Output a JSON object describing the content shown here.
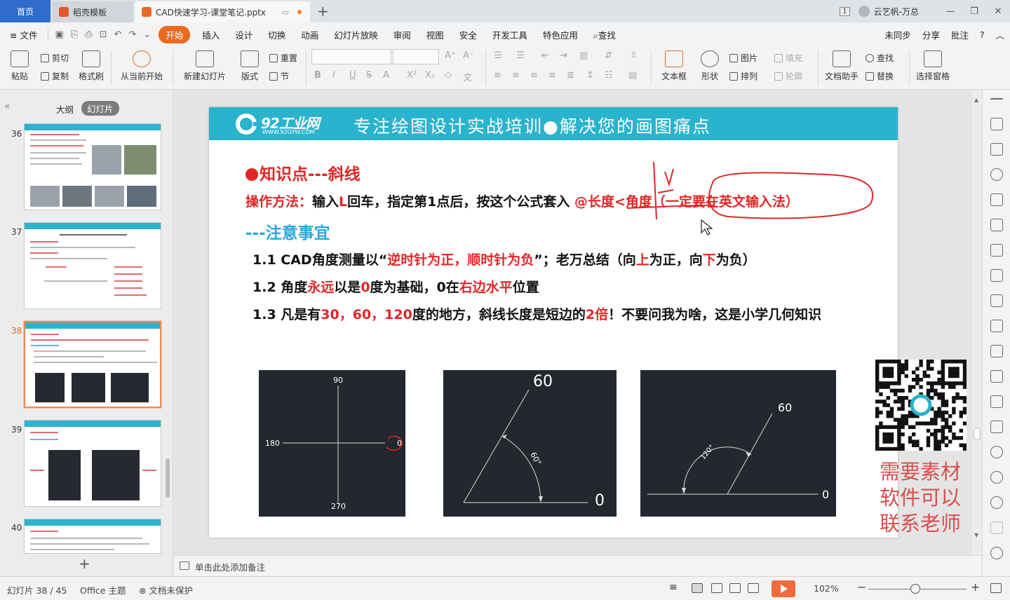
{
  "tabs": {
    "home": "首页",
    "template": "稻壳模板",
    "document": "CAD快速学习-课堂笔记.pptx",
    "add": "+"
  },
  "titlebar": {
    "window_count": "1",
    "user": "云艺帆-万总",
    "minimize": "—",
    "restore": "❐",
    "close": "✕"
  },
  "menu": {
    "file": "≡ 文件",
    "items": [
      "开始",
      "插入",
      "设计",
      "切换",
      "动画",
      "幻灯片放映",
      "审阅",
      "视图",
      "安全",
      "开发工具",
      "特色应用"
    ],
    "search": "查找",
    "right": [
      "未同步",
      "分享",
      "批注",
      "?",
      "︿"
    ]
  },
  "ribbon": {
    "paste": "粘贴",
    "cut": "剪切",
    "copy": "复制",
    "format_painter": "格式刷",
    "from_current": "从当前开始",
    "new_slide": "新建幻灯片",
    "layout": "版式",
    "reset": "重置",
    "section": "节",
    "textbox": "文本框",
    "shape": "形状",
    "picture": "图片",
    "arrange": "排列",
    "fill": "填充",
    "outline": "轮廓",
    "doc_assistant": "文档助手",
    "find": "查找",
    "replace": "替换",
    "select_pane": "选择窗格"
  },
  "left_pane": {
    "outline_tab": "大纲",
    "slides_tab": "幻灯片",
    "slide_numbers": [
      "36",
      "37",
      "38",
      "39",
      "40"
    ],
    "active_slide": "38",
    "add": "+"
  },
  "slide": {
    "brand_name": "92工业网",
    "brand_url": "WWW.92GYW.COM",
    "slogan": "专注绘图设计实战培训●解决您的画图痛点",
    "heading": "知识点---斜线",
    "method_label": "操作方法：",
    "method_text_1": "输入",
    "method_L": "L",
    "method_text_2": "回车，指定第1点后，按这个公式套入 ",
    "formula": "@长度<角度（一定要在英文输入法）",
    "notes_heading": "---注意事宜",
    "line1": {
      "prefix": "1.1 CAD角度测量以“",
      "red1": "逆时针为正，顺时针为负",
      "mid": "”；老万总结（向",
      "red2": "上",
      "mid2": "为正，向",
      "red3": "下",
      "suffix": "为负）"
    },
    "line2": {
      "prefix": "1.2 角度",
      "red1": "永远",
      "mid": "以是",
      "red2": "0",
      "mid2": "度为基础，0在",
      "red3": "右边水平",
      "suffix": "位置"
    },
    "line3": {
      "prefix": "1.3 凡是有",
      "red1": "30，60，120",
      "mid": "度的地方，斜线长度是短边的",
      "red2": "2倍",
      "suffix": "！不要问我为啥，这是小学几何知识"
    },
    "panel1": {
      "top": "90",
      "left": "180",
      "right": "0",
      "bottom": "270"
    },
    "panel2": {
      "top": "60",
      "angle": "60°",
      "right": "0"
    },
    "panel3": {
      "top": "60",
      "angle": "120°",
      "right": "0"
    },
    "promo": [
      "需要素材",
      "软件可以",
      "联系老师"
    ]
  },
  "notes": {
    "placeholder": "单击此处添加备注"
  },
  "status": {
    "slide_info": "幻灯片 38 / 45",
    "theme": "Office 主题",
    "protect": "文档未保护",
    "zoom": "102%",
    "zoom_minus": "−",
    "zoom_plus": "+"
  },
  "colors": {
    "accent_orange": "#ea6a22",
    "header_teal": "#2ab3cd",
    "text_red": "#e12626",
    "text_blue": "#2aa7d8",
    "panel_dark": "#23272e"
  }
}
